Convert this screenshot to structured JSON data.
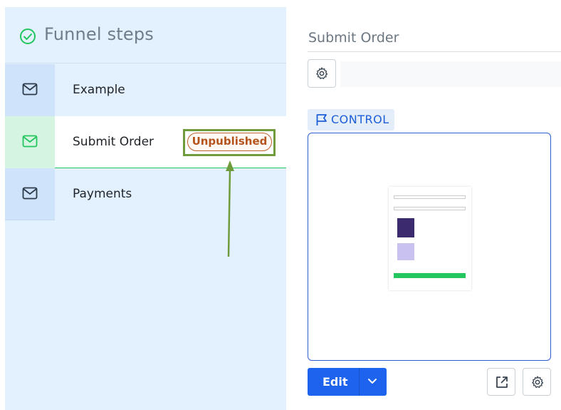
{
  "funnel": {
    "title": "Funnel steps",
    "steps": [
      {
        "label": "Example"
      },
      {
        "label": "Submit Order",
        "status": "Unpublished"
      },
      {
        "label": "Payments"
      }
    ]
  },
  "detail": {
    "title": "Submit Order",
    "variant_tag": "CONTROL",
    "edit_label": "Edit"
  },
  "colors": {
    "accent": "#1d63ed",
    "success": "#22c55e",
    "unpublished": "#c0602c",
    "annotation": "#6f9b3c"
  },
  "icons": [
    "check-circle-icon",
    "mail-icon",
    "gear-icon",
    "flag-icon",
    "chevron-down-icon",
    "external-link-icon"
  ]
}
